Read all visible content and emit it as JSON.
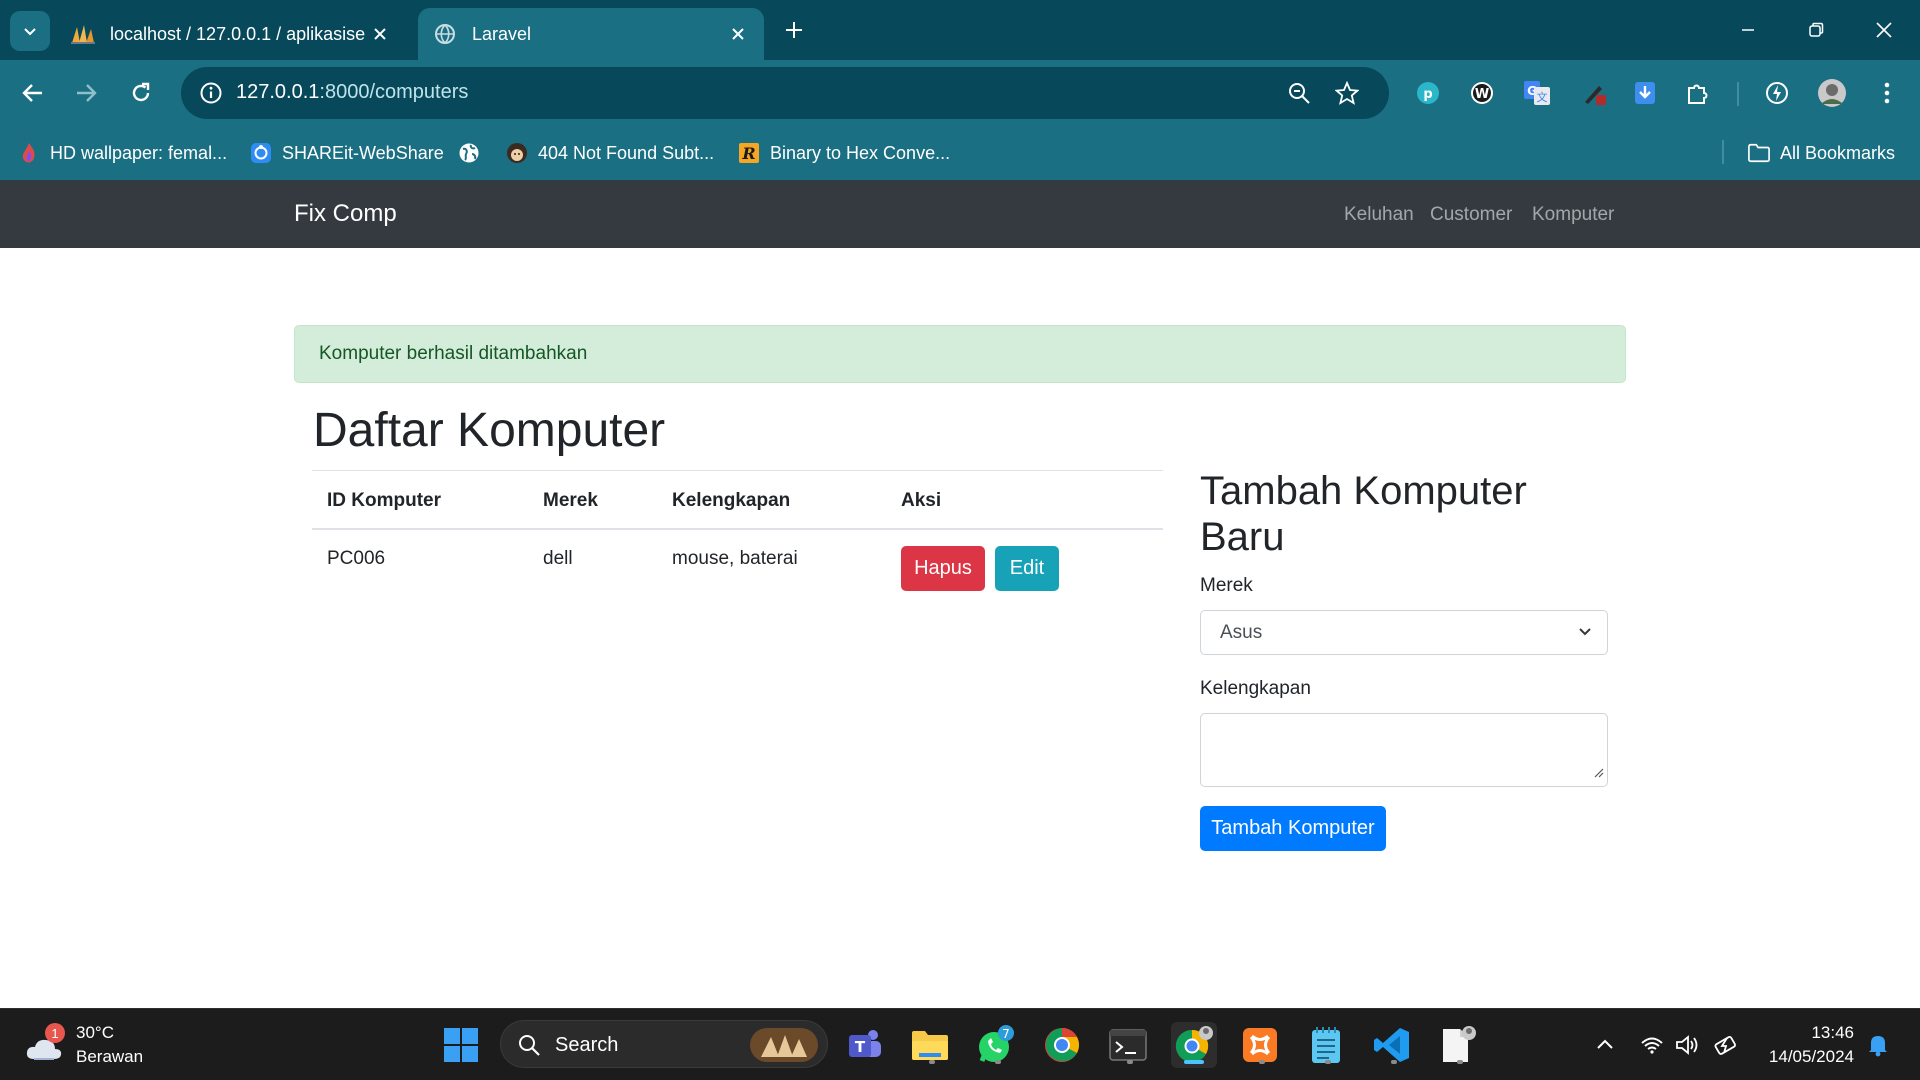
{
  "browser": {
    "tabs": [
      {
        "title": "localhost / 127.0.0.1 / aplikasise",
        "active": false
      },
      {
        "title": "Laravel",
        "active": true
      }
    ],
    "url_host": "127.0.0.1",
    "url_rest": ":8000/computers",
    "bookmarks": [
      {
        "label": "HD wallpaper: femal..."
      },
      {
        "label": "SHAREit-WebShare"
      },
      {
        "label": ""
      },
      {
        "label": "404 Not Found Subt..."
      },
      {
        "label": "Binary to Hex Conve..."
      }
    ],
    "all_bookmarks": "All Bookmarks"
  },
  "navbar": {
    "brand": "Fix Comp",
    "links": [
      "Keluhan",
      "Customer",
      "Komputer"
    ]
  },
  "alert": {
    "text": "Komputer berhasil ditambahkan"
  },
  "list": {
    "title": "Daftar Komputer",
    "headers": [
      "ID Komputer",
      "Merek",
      "Kelengkapan",
      "Aksi"
    ],
    "rows": [
      {
        "id": "PC006",
        "merek": "dell",
        "kelengkapan": "mouse, baterai",
        "hapus": "Hapus",
        "edit": "Edit"
      }
    ]
  },
  "form": {
    "title": "Tambah Komputer Baru",
    "merek_label": "Merek",
    "merek_value": "Asus",
    "kelengkapan_label": "Kelengkapan",
    "kelengkapan_value": "",
    "submit": "Tambah Komputer"
  },
  "taskbar": {
    "weather_temp": "30°C",
    "weather_cond": "Berawan",
    "weather_badge": "1",
    "search_label": "Search",
    "whatsapp_badge": "7",
    "time": "13:46",
    "date": "14/05/2024"
  },
  "colors": {
    "chrome_dark": "#07495a",
    "chrome": "#1b6f83",
    "navbar": "#343a40",
    "alert_bg": "#d4edda",
    "danger": "#dc3545",
    "info": "#17a2b8",
    "primary": "#007bff"
  }
}
